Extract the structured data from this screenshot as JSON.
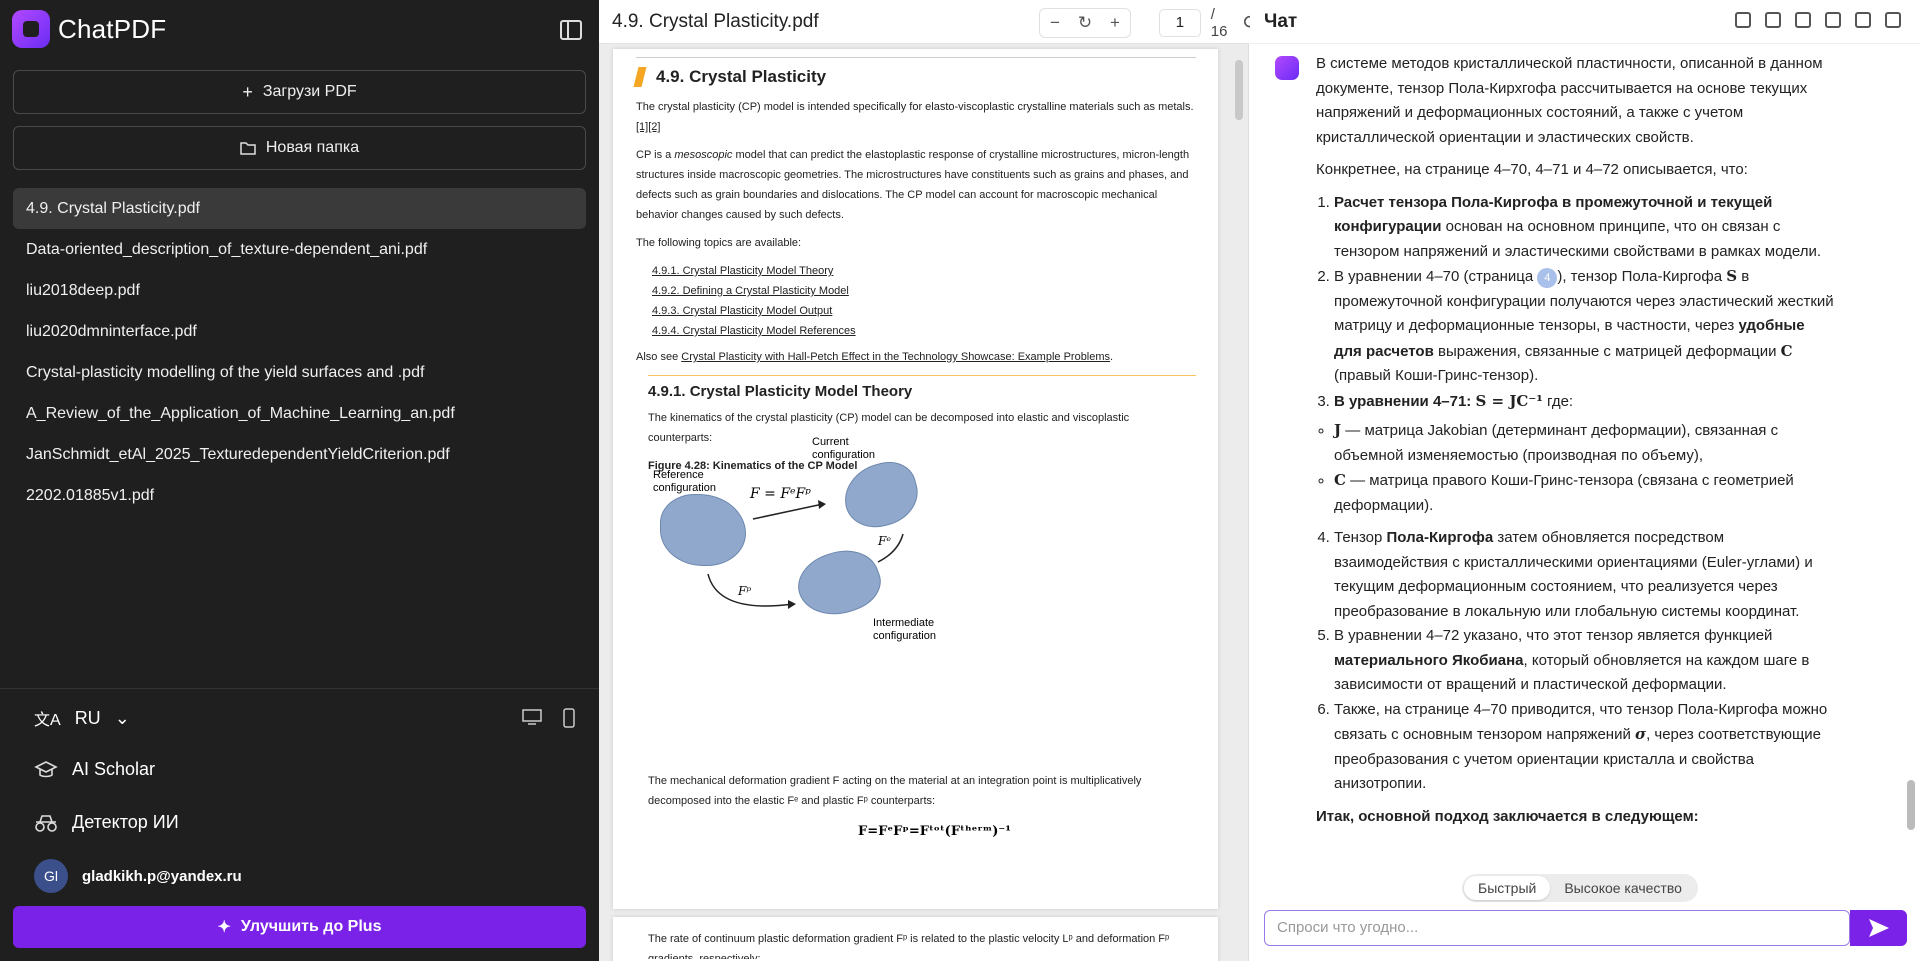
{
  "sidebar": {
    "brand": "ChatPDF",
    "upload_label": "Загрузи PDF",
    "new_folder_label": "Новая папка",
    "files": [
      "4.9. Crystal Plasticity.pdf",
      "Data-oriented_description_of_texture-dependent_ani.pdf",
      "liu2018deep.pdf",
      "liu2020dmninterface.pdf",
      "Crystal-plasticity modelling of the yield surfaces and .pdf",
      "A_Review_of_the_Application_of_Machine_Learning_an.pdf",
      "JanSchmidt_etAl_2025_TexturedependentYieldCriterion.pdf",
      "2202.01885v1.pdf"
    ],
    "language": "RU",
    "ai_scholar": "AI Scholar",
    "ai_detector": "Детектор ИИ",
    "user_initials": "Gl",
    "user_email": "gladkikh.p@yandex.ru",
    "upgrade_label": "Улучшить до Plus"
  },
  "pdf": {
    "title": "4.9. Crystal Plasticity.pdf",
    "page": "1",
    "total": "/ 16",
    "content": {
      "h1": "4.9. Crystal Plasticity",
      "p1": "The crystal plasticity (CP) model is intended specifically for elasto-viscoplastic crystalline materials such as metals.",
      "p1_refs": "[1][2]",
      "p2a": "CP is a ",
      "p2_em": "mesoscopic",
      "p2b": " model that can predict the elastoplastic response of crystalline microstructures, micron-length structures inside macroscopic geometries. The microstructures have constituents such as grains and phases, and defects such as grain boundaries and dislocations. The CP model can account for macroscopic mechanical behavior changes caused by such defects.",
      "p3": "The following topics are available:",
      "topics": [
        "4.9.1. Crystal Plasticity Model Theory",
        "4.9.2. Defining a Crystal Plasticity Model",
        "4.9.3. Crystal Plasticity Model Output",
        "4.9.4. Crystal Plasticity Model References"
      ],
      "see_also_a": "Also see ",
      "see_also_link": "Crystal Plasticity with Hall-Petch Effect in the Technology Showcase: Example Problems",
      "see_also_b": ".",
      "h2": "4.9.1. Crystal Plasticity Model Theory",
      "p4": "The kinematics of the crystal plasticity (CP) model can be decomposed into elastic and viscoplastic counterparts:",
      "fig_caption": "Figure 4.28: Kinematics of the CP Model",
      "fig_current": "Current configuration",
      "fig_reference": "Reference configuration",
      "fig_intermediate": "Intermediate configuration",
      "fig_eq": "F = FᵉFᵖ",
      "fig_fe": "Fᵉ",
      "fig_fp": "Fᵖ",
      "p5": "The mechanical deformation gradient F acting on the material at an integration point is multiplicatively decomposed into the elastic Fᵉ and plastic Fᵖ counterparts:",
      "eq": "F=FᵉFᵖ=Fᵗᵒᵗ(Fᵗʰᵉʳᵐ)⁻¹",
      "p6": "The rate of continuum plastic deformation gradient Fᵖ is related to the plastic velocity Lᵖ and deformation Fᵖ gradients, respectively:"
    }
  },
  "chat": {
    "title": "Чат",
    "intro": "В системе методов кристаллической пластичности, описанной в данном документе, тензор Пола-Кирхгофа рассчитывается на основе текущих напряжений и деформационных состояний, а также с учетом кристаллической ориентации и эластических свойств.",
    "lead": "Конкретнее, на странице 4–70, 4–71 и 4–72 описывается, что:",
    "item1_bold": "Расчет тензора Пола-Киргофа в промежуточной и текущей конфигурации",
    "item1_rest": " основан на основном принципе, что он связан с тензором напряжений и эластическими свойствами в рамках модели.",
    "item2_a": "В уравнении 4–70 (страница ",
    "item2_badge": "4",
    "item2_b": "), тензор Пола-Киргофа ",
    "item2_sym": "S",
    "item2_c": " в промежуточной конфигурации получаются через эластический жесткий матрицу и деформационные тензоры, в частности, через ",
    "item2_bold": "удобные для расчетов",
    "item2_d": " выражения, связанные с матрицей деформации ",
    "item2_sym2": "C",
    "item2_e": " (правый Коши-Гринс-тензор).",
    "item3_bold": "В уравнении 4–71:",
    "item3_eq": "S = JC⁻¹",
    "item3_rest": " где:",
    "sub1_sym": "J",
    "sub1": " — матрица Jakobian (детерминант деформации), связанная с объемной изменяемостью (производная по объему),",
    "sub2_sym": "C",
    "sub2": " — матрица правого Коши-Гринс-тензора (связана с геометрией деформации).",
    "item4_a": "Тензор ",
    "item4_bold": "Пола-Киргофа",
    "item4_b": " затем обновляется посредством взаимодействия с кристаллическими ориентациями (Euler-углами) и текущим деформационным состоянием, что реализуется через преобразование в локальную или глобальную системы координат.",
    "item5_a": "В уравнении 4–72 указано, что этот тензор является функцией ",
    "item5_bold": "материального Якобиана",
    "item5_b": ", который обновляется на каждом шаге в зависимости от вращений и пластической деформации.",
    "item6_a": "Также, на странице 4–70 приводится, что тензор Пола-Киргофа можно связать с основным тензором напряжений ",
    "item6_sym": "σ",
    "item6_b": ", через соответствующие преобразования с учетом ориентации кристалла и свойства анизотропии.",
    "conclusion": "Итак, основной подход заключается в следующем:",
    "mode_fast": "Быстрый",
    "mode_quality": "Высокое качество",
    "input_placeholder": "Спроси что угодно..."
  }
}
